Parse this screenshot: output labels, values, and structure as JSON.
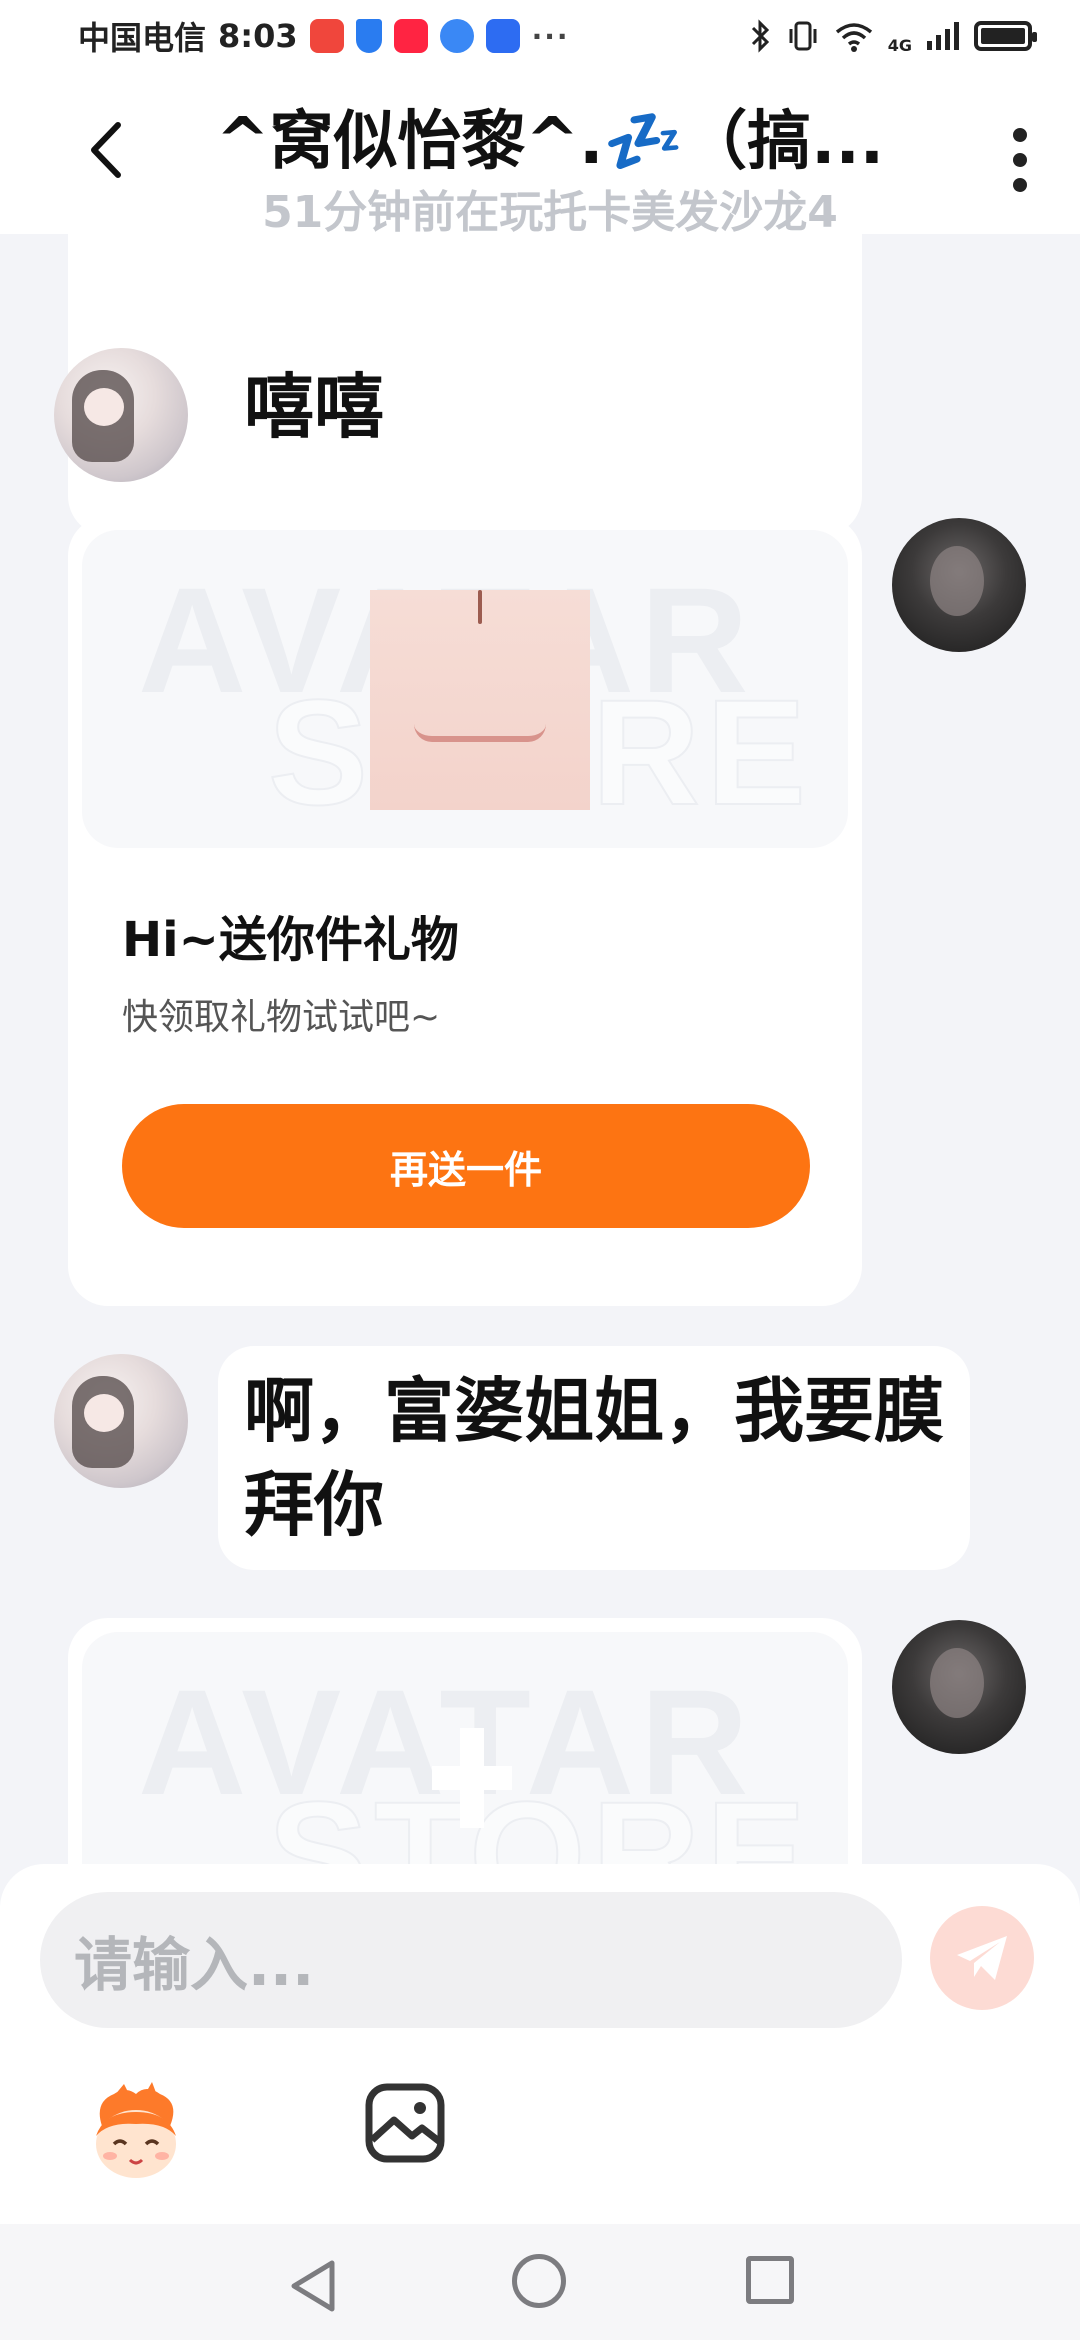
{
  "status_bar": {
    "carrier": "中国电信",
    "time": "8:03",
    "dots": "···",
    "network": "4G",
    "app_icons": [
      {
        "name": "huawei-app-icon",
        "color": "#f0463c"
      },
      {
        "name": "shield-app-icon",
        "color": "#2a7cf0"
      },
      {
        "name": "xiaohongshu-app-icon",
        "color": "#ff2442"
      },
      {
        "name": "browser-app-icon",
        "color": "#3a88f5"
      },
      {
        "name": "bulb-app-icon",
        "color": "#2d6cf2"
      }
    ]
  },
  "header": {
    "title": "^窝似怡黎^.💤（搞...",
    "subtitle": "51分钟前在玩托卡美发沙龙4"
  },
  "messages": {
    "m1_text": "嘻嘻",
    "gift_card_1": {
      "watermark_1": "AVATAR",
      "watermark_2": "STORE",
      "title": "Hi~送你件礼物",
      "subtitle": "快领取礼物试试吧~",
      "button": "再送一件"
    },
    "m2_text": "啊，富婆姐姐，我要膜拜你",
    "gift_card_2": {
      "watermark_1": "AVATAR",
      "watermark_2": "STORE"
    }
  },
  "input": {
    "placeholder": "请输入..."
  },
  "colors": {
    "accent": "#fd7412",
    "background": "#f3f4f8",
    "send_disabled": "#fddbd4"
  }
}
